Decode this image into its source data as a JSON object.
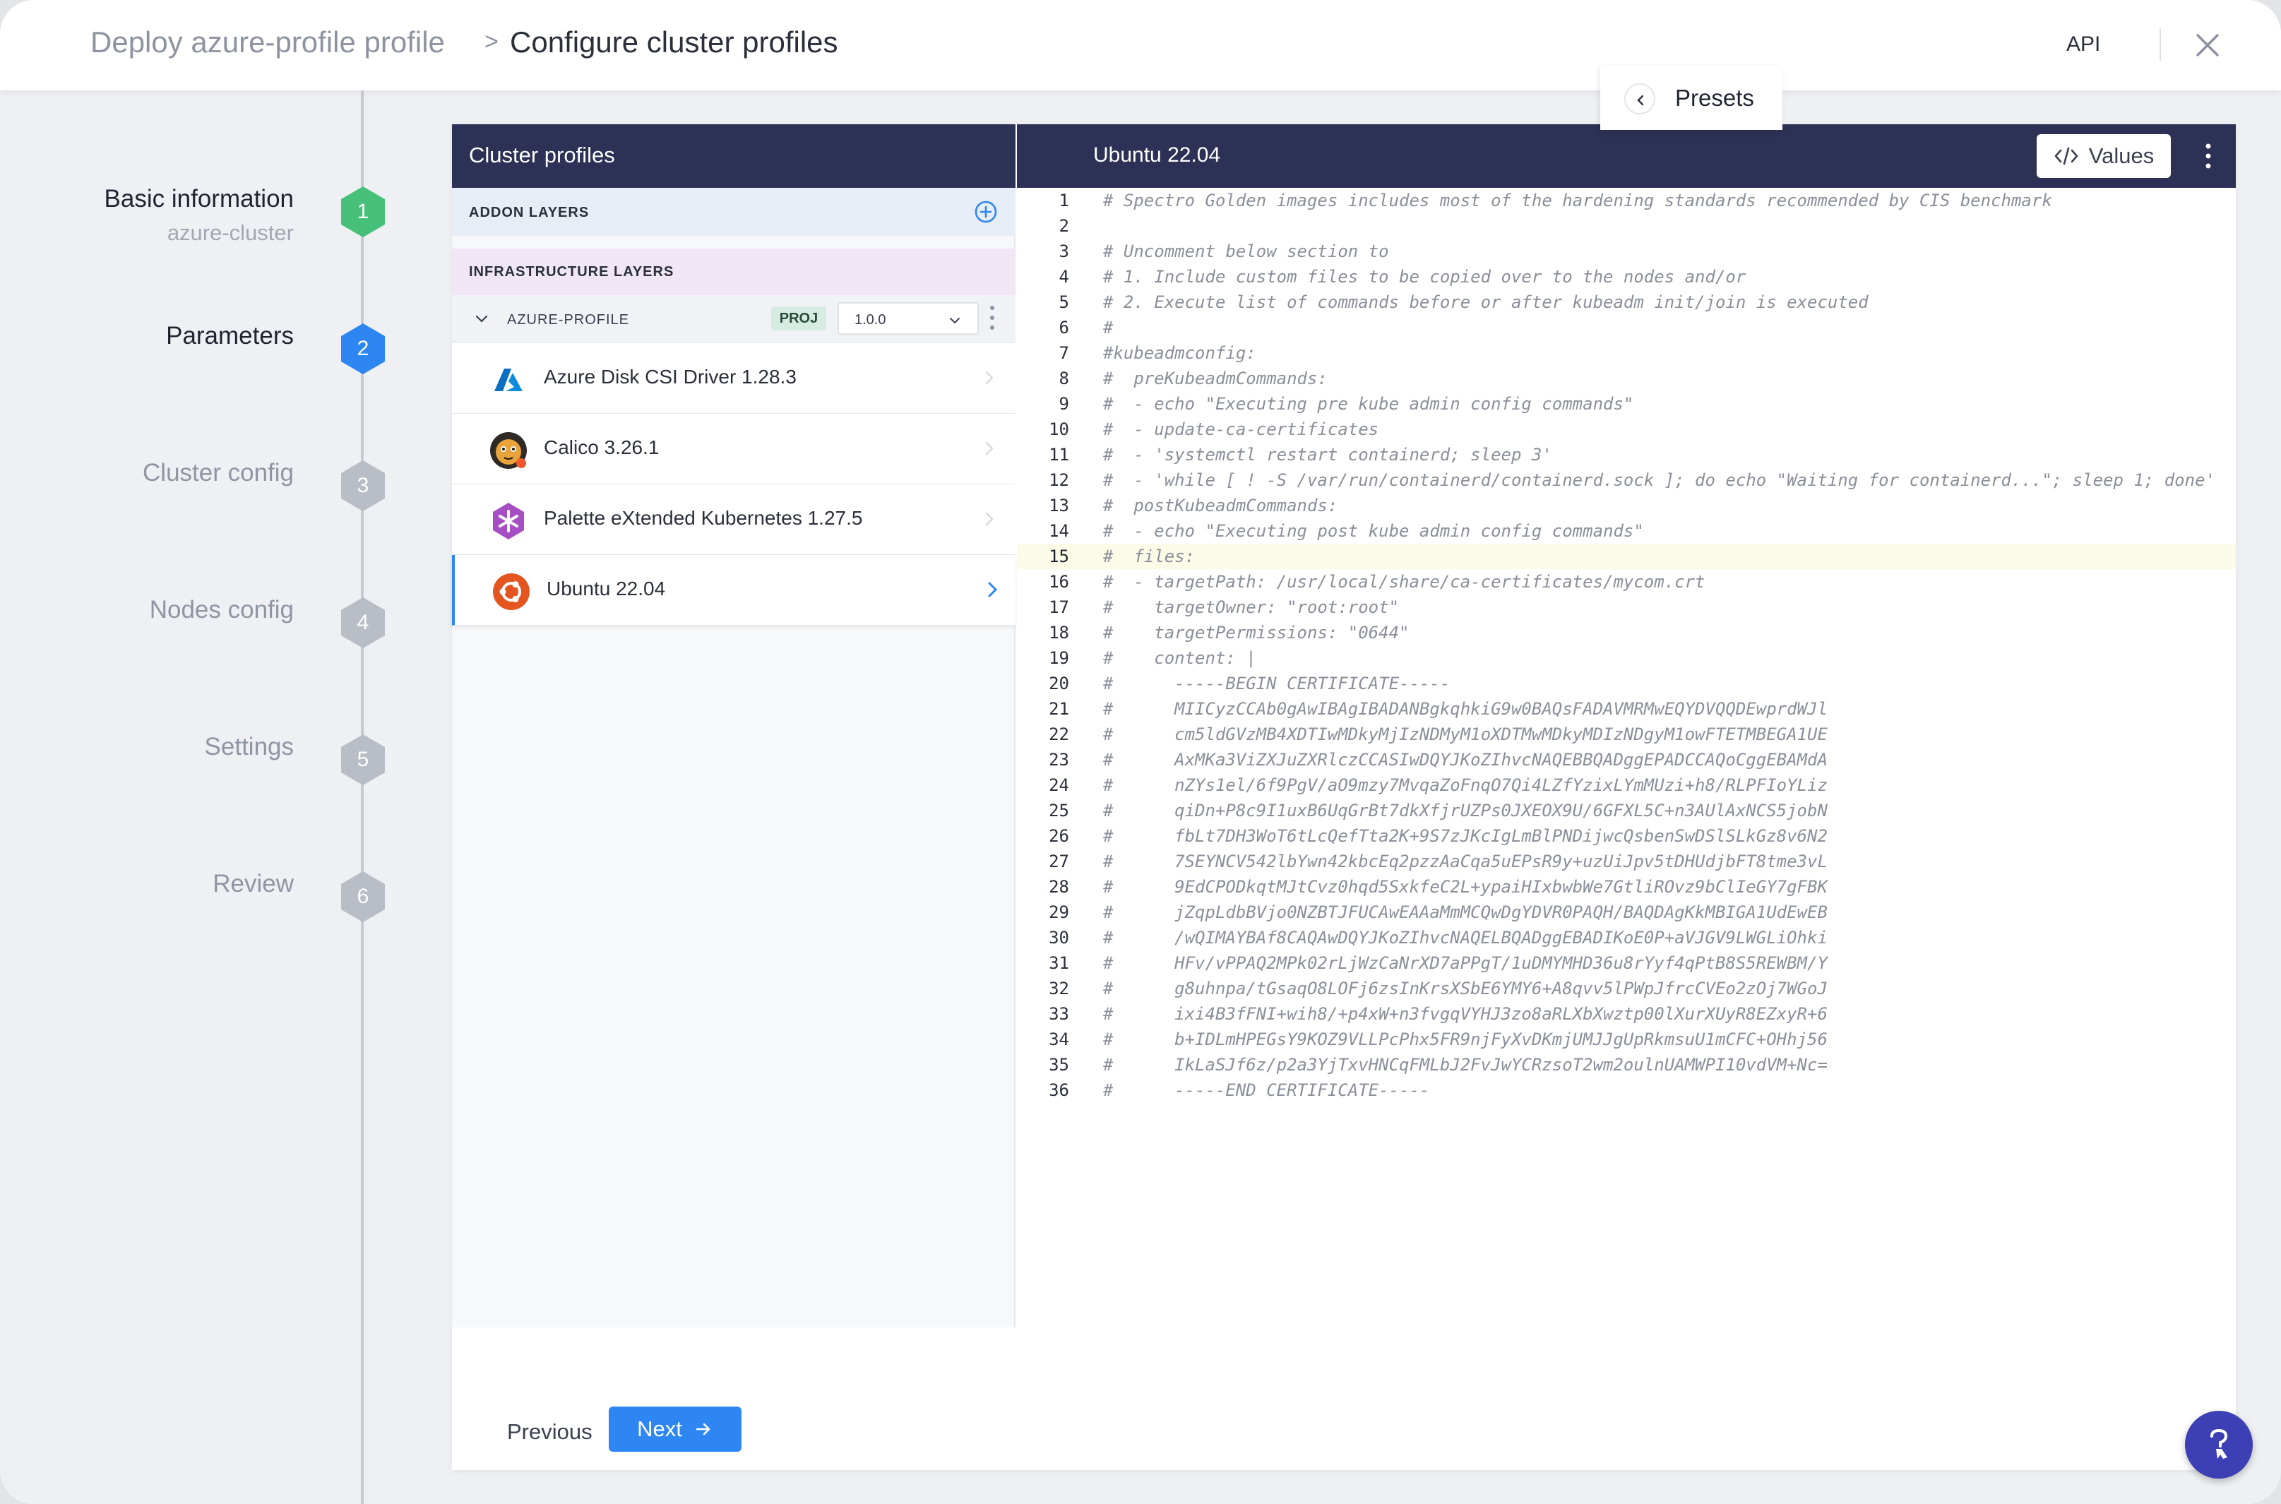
{
  "header": {
    "breadcrumb_parent": "Deploy azure-profile profile",
    "breadcrumb_separator": ">",
    "breadcrumb_current": "Configure cluster profiles",
    "api_label": "API"
  },
  "stepper": {
    "steps": [
      {
        "label": "Basic information",
        "number": "1",
        "state": "done",
        "sublabel": "azure-cluster"
      },
      {
        "label": "Parameters",
        "number": "2",
        "state": "current"
      },
      {
        "label": "Cluster config",
        "number": "3",
        "state": "todo"
      },
      {
        "label": "Nodes config",
        "number": "4",
        "state": "todo"
      },
      {
        "label": "Settings",
        "number": "5",
        "state": "todo"
      },
      {
        "label": "Review",
        "number": "6",
        "state": "todo"
      }
    ]
  },
  "left_panel": {
    "title": "Cluster profiles",
    "addon_layers_title": "ADDON LAYERS",
    "infra_layers_title": "INFRASTRUCTURE LAYERS",
    "profile": {
      "name": "AZURE-PROFILE",
      "scope_badge": "PROJ",
      "version": "1.0.0"
    },
    "layers": [
      {
        "name": "Azure Disk CSI Driver 1.28.3",
        "icon": "azure-icon"
      },
      {
        "name": "Calico 3.26.1",
        "icon": "calico-icon"
      },
      {
        "name": "Palette eXtended Kubernetes 1.27.5",
        "icon": "kubernetes-icon"
      },
      {
        "name": "Ubuntu 22.04",
        "icon": "ubuntu-icon",
        "selected": true
      }
    ]
  },
  "editor": {
    "title": "Ubuntu 22.04",
    "values_label": "Values",
    "presets_label": "Presets",
    "current_line": 15,
    "lines": [
      "# Spectro Golden images includes most of the hardening standards recommended by CIS benchmark",
      "",
      "# Uncomment below section to",
      "# 1. Include custom files to be copied over to the nodes and/or",
      "# 2. Execute list of commands before or after kubeadm init/join is executed",
      "#",
      "#kubeadmconfig:",
      "#  preKubeadmCommands:",
      "#  - echo \"Executing pre kube admin config commands\"",
      "#  - update-ca-certificates",
      "#  - 'systemctl restart containerd; sleep 3'",
      "#  - 'while [ ! -S /var/run/containerd/containerd.sock ]; do echo \"Waiting for containerd...\"; sleep 1; done'",
      "#  postKubeadmCommands:",
      "#  - echo \"Executing post kube admin config commands\"",
      "#  files:",
      "#  - targetPath: /usr/local/share/ca-certificates/mycom.crt",
      "#    targetOwner: \"root:root\"",
      "#    targetPermissions: \"0644\"",
      "#    content: |",
      "#      -----BEGIN CERTIFICATE-----",
      "#      MIICyzCCAb0gAwIBAgIBADANBgkqhkiG9w0BAQsFADAVMRMwEQYDVQQDEwprdWJl",
      "#      cm5ldGVzMB4XDTIwMDkyMjIzNDMyM1oXDTMwMDkyMDIzNDgyM1owFTETMBEGA1UE",
      "#      AxMKa3ViZXJuZXRlczCCASIwDQYJKoZIhvcNAQEBBQADggEPADCCAQoCggEBAMdA",
      "#      nZYs1el/6f9PgV/aO9mzy7MvqaZoFnqO7Qi4LZfYzixLYmMUzi+h8/RLPFIoYLiz",
      "#      qiDn+P8c9I1uxB6UqGrBt7dkXfjrUZPs0JXEOX9U/6GFXL5C+n3AUlAxNCS5jobN",
      "#      fbLt7DH3WoT6tLcQefTta2K+9S7zJKcIgLmBlPNDijwcQsbenSwDSlSLkGz8v6N2",
      "#      7SEYNCV542lbYwn42kbcEq2pzzAaCqa5uEPsR9y+uzUiJpv5tDHUdjbFT8tme3vL",
      "#      9EdCPODkqtMJtCvz0hqd5SxkfeC2L+ypaiHIxbwbWe7GtliROvz9bClIeGY7gFBK",
      "#      jZqpLdbBVjo0NZBTJFUCAwEAAaMmMCQwDgYDVR0PAQH/BAQDAgKkMBIGA1UdEwEB",
      "#      /wQIMAYBAf8CAQAwDQYJKoZIhvcNAQELBQADggEBADIKoE0P+aVJGV9LWGLiOhki",
      "#      HFv/vPPAQ2MPk02rLjWzCaNrXD7aPPgT/1uDMYMHD36u8rYyf4qPtB8S5REWBM/Y",
      "#      g8uhnpa/tGsaqO8LOFj6zsInKrsXSbE6YMY6+A8qvv5lPWpJfrcCVEo2zOj7WGoJ",
      "#      ixi4B3fFNI+wih8/+p4xW+n3fvgqVYHJ3zo8aRLXbXwztp00lXurXUyR8EZxyR+6",
      "#      b+IDLmHPEGsY9KOZ9VLLPcPhx5FR9njFyXvDKmjUMJJgUpRkmsuU1mCFC+OHhj56",
      "#      IkLaSJf6z/p2a3YjTxvHNCqFMLbJ2FvJwYCRzsoT2wm2oulnUAMWPI10vdVM+Nc=",
      "#      -----END CERTIFICATE-----"
    ]
  },
  "footer": {
    "previous_label": "Previous",
    "next_label": "Next"
  },
  "colors": {
    "header_bar": "#2c3155",
    "primary": "#2e86f2",
    "step_done": "#47c17a",
    "step_todo": "#b9bdc5",
    "help_fab": "#3d3fb4"
  }
}
